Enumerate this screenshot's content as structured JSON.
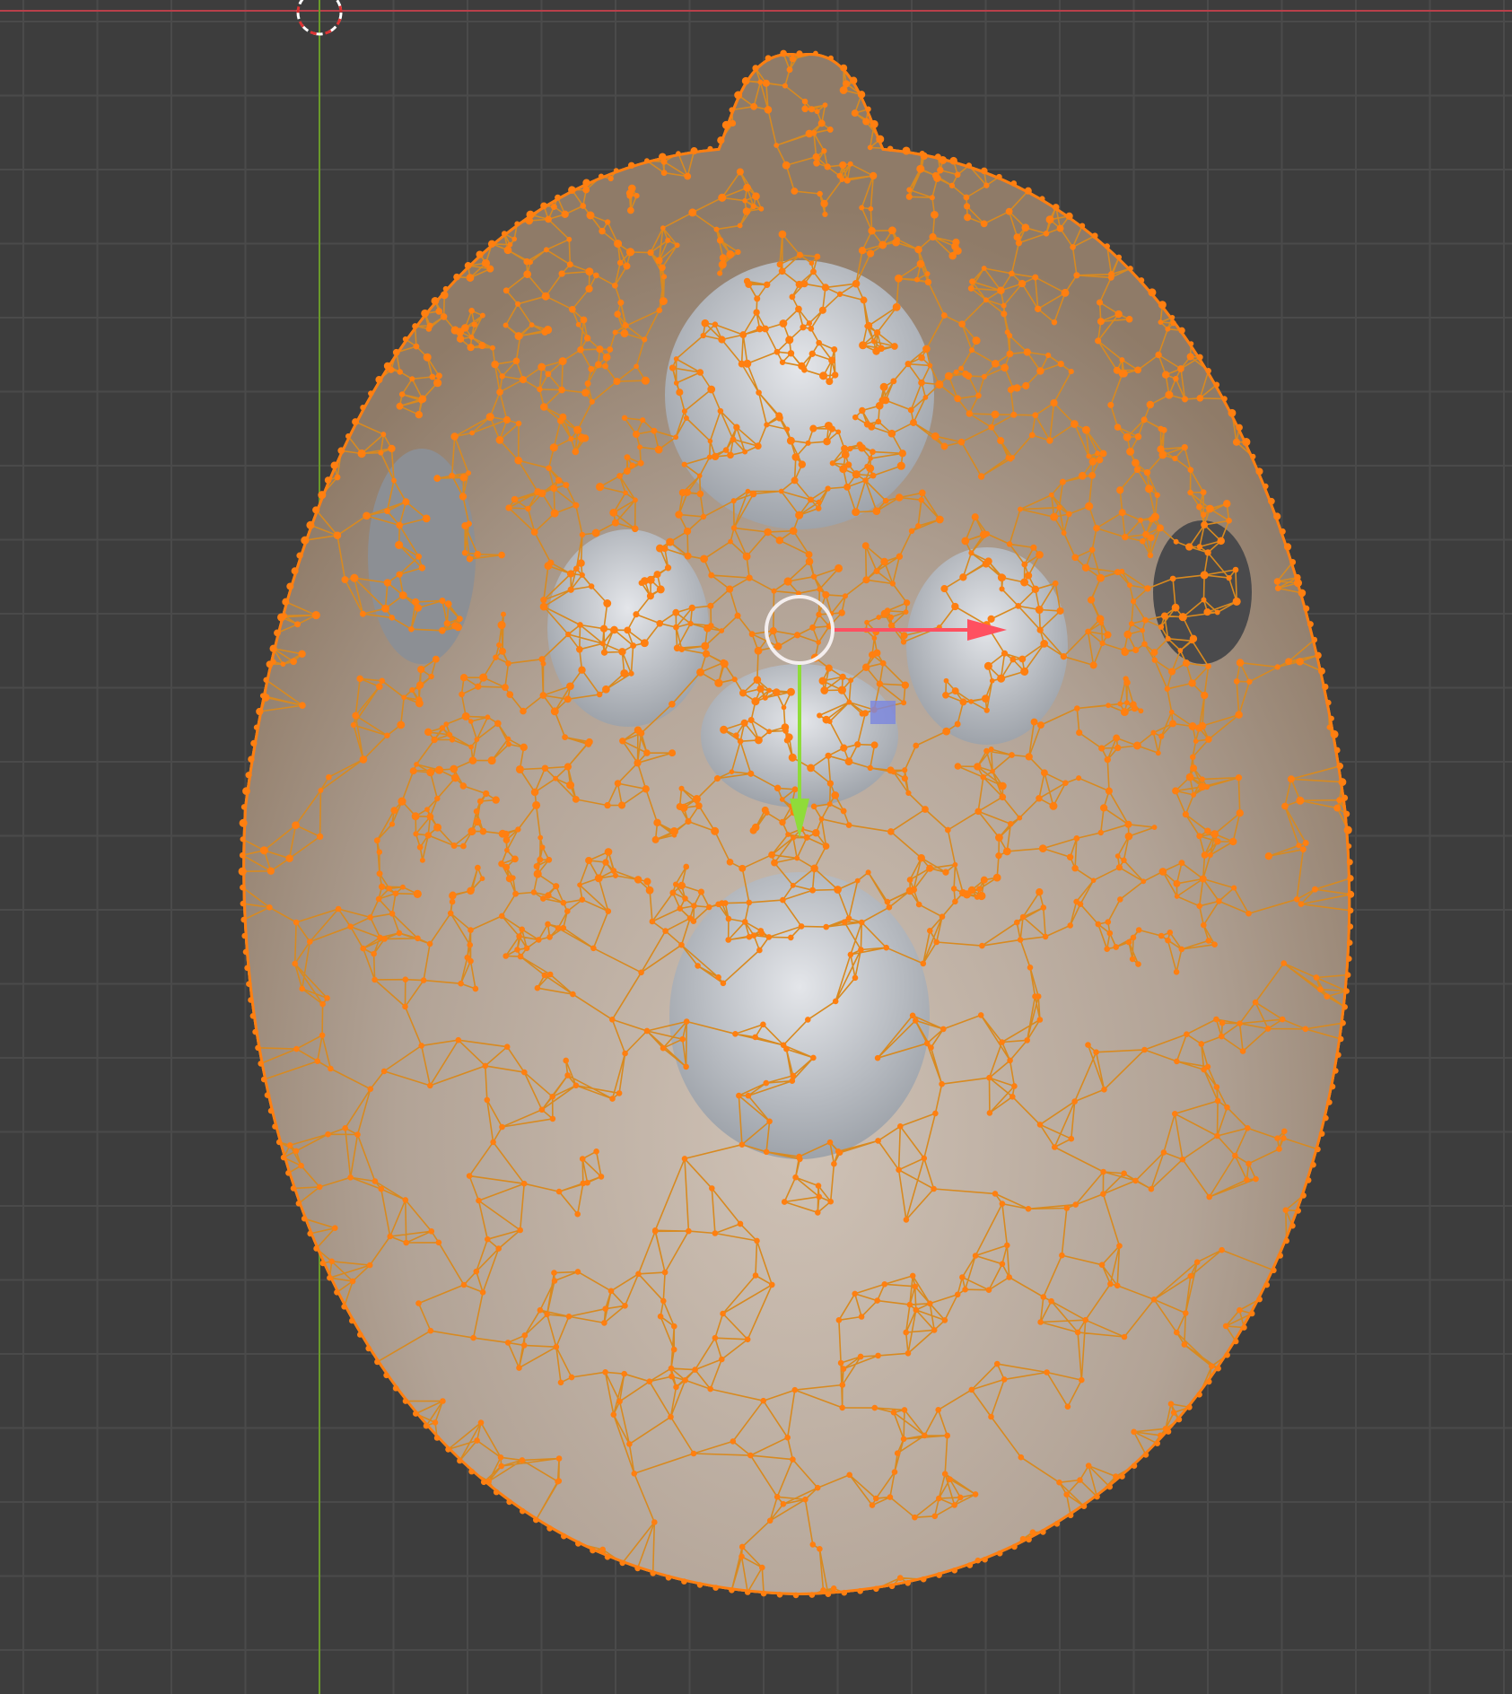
{
  "viewport": {
    "mode": "edit-mode",
    "object": "skull-mesh",
    "colors": {
      "background": "#3d3d3d",
      "grid": "#4a4a4a",
      "x_axis": "#c0404c",
      "y_axis": "#6a9a2a",
      "selected": "#ff7f10",
      "edge": "#d88a20",
      "surface": "#b8aea6",
      "gizmo_x": "#ff5060",
      "gizmo_y": "#8fdc3a",
      "gizmo_z": "#7080e0"
    }
  }
}
